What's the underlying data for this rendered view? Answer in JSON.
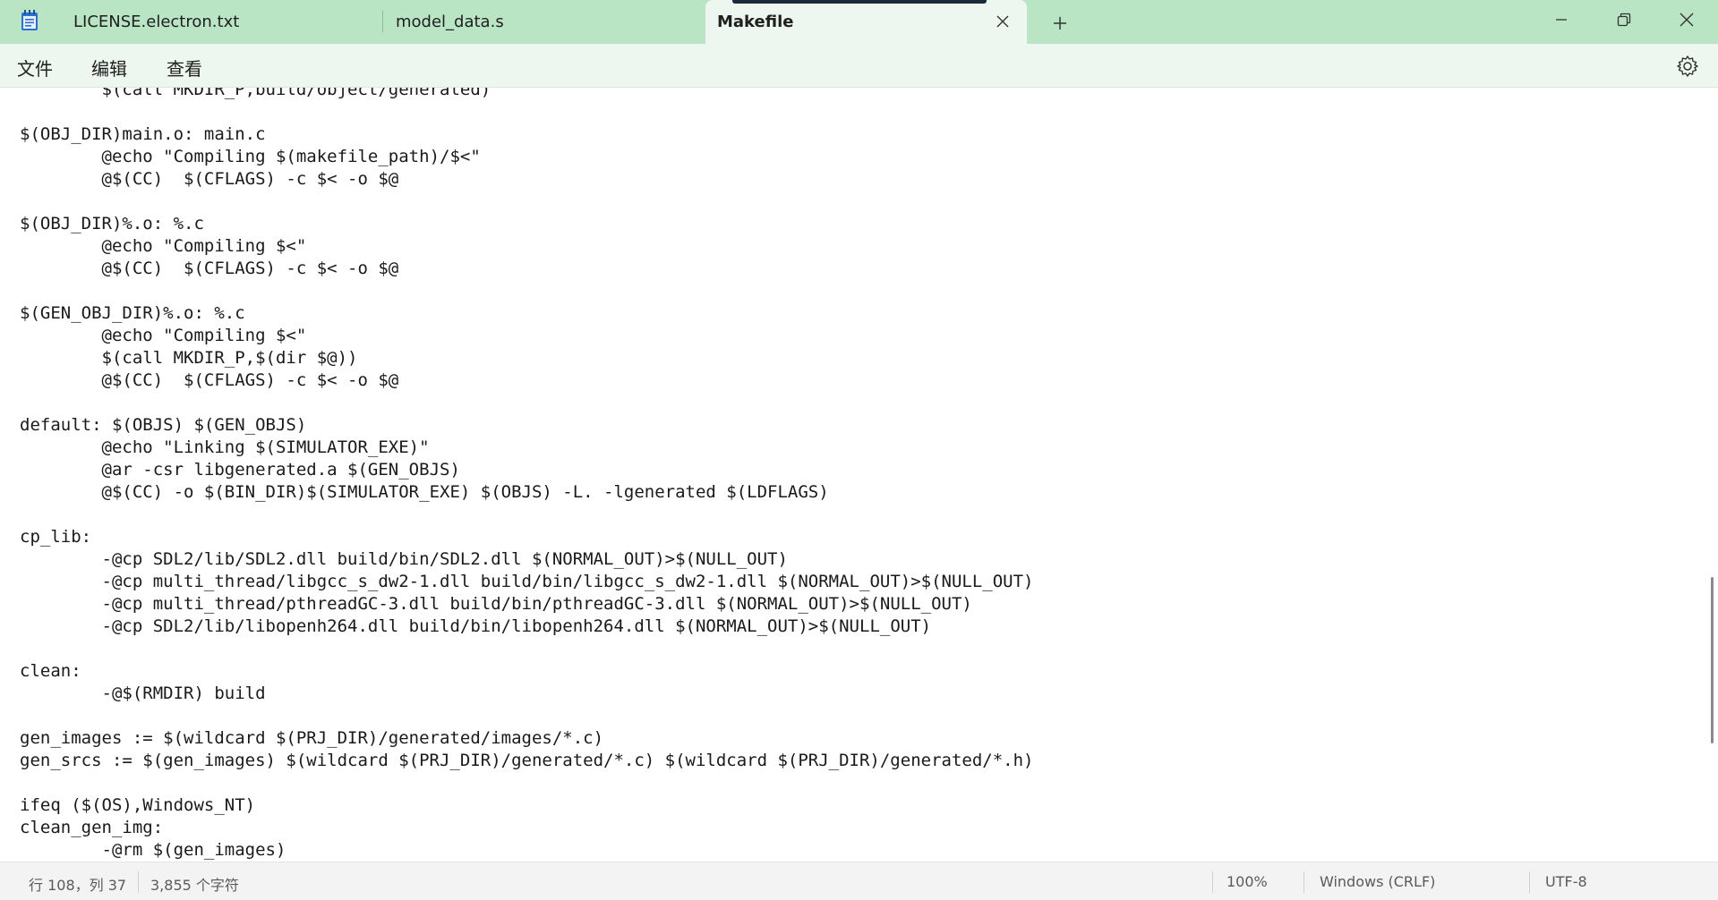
{
  "titlebar": {
    "tabs": [
      {
        "label": "LICENSE.electron.txt",
        "active": false
      },
      {
        "label": "model_data.s",
        "active": false
      },
      {
        "label": "Makefile",
        "active": true
      }
    ],
    "icons": {
      "app": "notepad-icon",
      "close_tab": "close-icon",
      "new_tab": "plus-icon",
      "minimize": "minimize-icon",
      "maximize": "restore-icon",
      "close_window": "close-icon"
    }
  },
  "menu": {
    "items": [
      "文件",
      "编辑",
      "查看"
    ],
    "settings_icon": "gear-icon"
  },
  "editor": {
    "lines": [
      "\t$(call MKDIR_P,build/object/generated)",
      "",
      "$(OBJ_DIR)main.o: main.c",
      "\t@echo \"Compiling $(makefile_path)/$<\"",
      "\t@$(CC)  $(CFLAGS) -c $< -o $@",
      "",
      "$(OBJ_DIR)%.o: %.c",
      "\t@echo \"Compiling $<\"",
      "\t@$(CC)  $(CFLAGS) -c $< -o $@",
      "",
      "$(GEN_OBJ_DIR)%.o: %.c",
      "\t@echo \"Compiling $<\"",
      "\t$(call MKDIR_P,$(dir $@))",
      "\t@$(CC)  $(CFLAGS) -c $< -o $@",
      "",
      "default: $(OBJS) $(GEN_OBJS)",
      "\t@echo \"Linking $(SIMULATOR_EXE)\"",
      "\t@ar -csr libgenerated.a $(GEN_OBJS)",
      "\t@$(CC) -o $(BIN_DIR)$(SIMULATOR_EXE) $(OBJS) -L. -lgenerated $(LDFLAGS)",
      "",
      "cp_lib:",
      "\t-@cp SDL2/lib/SDL2.dll build/bin/SDL2.dll $(NORMAL_OUT)>$(NULL_OUT)",
      "\t-@cp multi_thread/libgcc_s_dw2-1.dll build/bin/libgcc_s_dw2-1.dll $(NORMAL_OUT)>$(NULL_OUT)",
      "\t-@cp multi_thread/pthreadGC-3.dll build/bin/pthreadGC-3.dll $(NORMAL_OUT)>$(NULL_OUT)",
      "\t-@cp SDL2/lib/libopenh264.dll build/bin/libopenh264.dll $(NORMAL_OUT)>$(NULL_OUT)",
      "",
      "clean:",
      "\t-@$(RMDIR) build",
      "",
      "gen_images := $(wildcard $(PRJ_DIR)/generated/images/*.c)",
      "gen_srcs := $(gen_images) $(wildcard $(PRJ_DIR)/generated/*.c) $(wildcard $(PRJ_DIR)/generated/*.h)",
      "",
      "ifeq ($(OS),Windows_NT)",
      "clean_gen_img:",
      "\t-@rm $(gen_images)"
    ]
  },
  "statusbar": {
    "position": "行 108，列 37",
    "char_count": "3,855 个字符",
    "zoom": "100%",
    "line_ending": "Windows (CRLF)",
    "encoding": "UTF-8"
  },
  "colors": {
    "titlebar_bg": "#b9e5c4",
    "active_tab_bg": "#edf7ef",
    "menubar_bg": "#edf7ef",
    "editor_bg": "#ffffff",
    "statusbar_bg": "#f3f3f3"
  }
}
